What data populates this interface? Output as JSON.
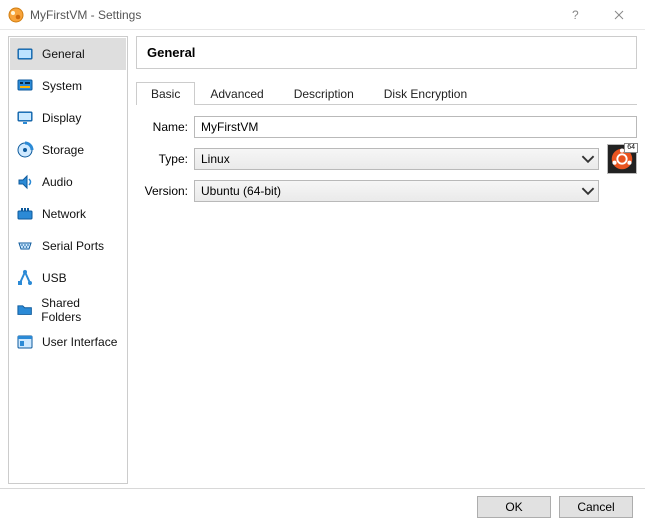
{
  "window": {
    "title": "MyFirstVM - Settings"
  },
  "sidebar": {
    "items": [
      {
        "label": "General"
      },
      {
        "label": "System"
      },
      {
        "label": "Display"
      },
      {
        "label": "Storage"
      },
      {
        "label": "Audio"
      },
      {
        "label": "Network"
      },
      {
        "label": "Serial Ports"
      },
      {
        "label": "USB"
      },
      {
        "label": "Shared Folders"
      },
      {
        "label": "User Interface"
      }
    ]
  },
  "page": {
    "title": "General",
    "tabs": [
      {
        "label": "Basic"
      },
      {
        "label": "Advanced"
      },
      {
        "label": "Description"
      },
      {
        "label": "Disk Encryption"
      }
    ]
  },
  "form": {
    "name_label": "Name:",
    "name_value": "MyFirstVM",
    "type_label": "Type:",
    "type_value": "Linux",
    "version_label": "Version:",
    "version_value": "Ubuntu (64-bit)",
    "badge": "64"
  },
  "footer": {
    "ok_label": "OK",
    "cancel_label": "Cancel"
  }
}
